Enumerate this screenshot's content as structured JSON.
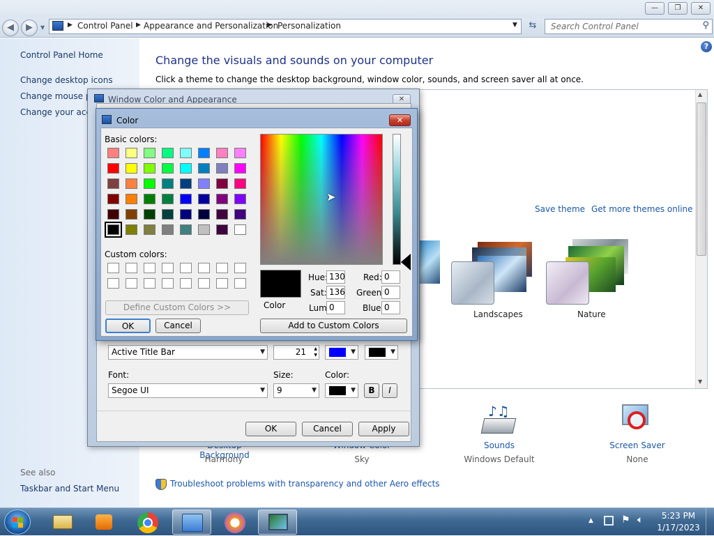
{
  "window": {
    "minimize_glyph": "—",
    "maximize_glyph": "❐",
    "close_glyph": "✕"
  },
  "address": {
    "back_glyph": "◀",
    "forward_glyph": "▶",
    "crumbs": [
      "Control Panel",
      "Appearance and Personalization",
      "Personalization"
    ],
    "search_placeholder": "Search Control Panel"
  },
  "sidebar": {
    "home": "Control Panel Home",
    "links": [
      "Change desktop icons",
      "Change mouse po",
      "Change your acco"
    ],
    "see_also_heading": "See also",
    "see_also_links": [
      "Taskbar and Start Menu"
    ]
  },
  "main": {
    "title": "Change the visuals and sounds on your computer",
    "subtitle": "Click a theme to change the desktop background, window color, sounds, and screen saver all at once.",
    "save_theme": "Save theme",
    "more_themes": "Get more themes online",
    "themes": [
      {
        "name": "Landscapes"
      },
      {
        "name": "Nature"
      }
    ],
    "bottom_items": [
      {
        "label": "Desktop Background",
        "value": "Harmony"
      },
      {
        "label": "Window Color",
        "value": "Sky"
      },
      {
        "label": "Sounds",
        "value": "Windows Default"
      },
      {
        "label": "Screen Saver",
        "value": "None"
      }
    ],
    "troubleshoot": "Troubleshoot problems with transparency and other Aero effects"
  },
  "wca_dialog": {
    "title": "Window Color and Appearance",
    "item_value": "Active Title Bar",
    "size_value": "21",
    "font_label": "Font:",
    "font_value": "Segoe UI",
    "size_label": "Size:",
    "font_size_value": "9",
    "color_label": "Color:",
    "bold_label": "B",
    "italic_label": "I",
    "ok": "OK",
    "cancel": "Cancel",
    "apply": "Apply",
    "color1": "#0000ff",
    "color2": "#000000"
  },
  "color_dialog": {
    "title": "Color",
    "basic_colors_label": "Basic colors:",
    "custom_colors_label": "Custom colors:",
    "define_custom": "Define Custom Colors >>",
    "ok": "OK",
    "cancel": "Cancel",
    "add_custom": "Add to Custom Colors",
    "color_solid_label": "Color",
    "hue_label": "Hue:",
    "hue": "130",
    "sat_label": "Sat:",
    "sat": "136",
    "lum_label": "Lum:",
    "lum": "0",
    "red_label": "Red:",
    "red": "0",
    "green_label": "Green:",
    "green": "0",
    "blue_label": "Blue:",
    "blue": "0",
    "selected_color": "#000000",
    "basic_colors": [
      "#ff8080",
      "#ffff80",
      "#80ff80",
      "#00ff80",
      "#80ffff",
      "#0080ff",
      "#ff80c0",
      "#ff80ff",
      "#ff0000",
      "#ffff00",
      "#80ff00",
      "#00ff40",
      "#00ffff",
      "#0080c0",
      "#8080c0",
      "#ff00ff",
      "#804040",
      "#ff8040",
      "#00ff00",
      "#008080",
      "#004080",
      "#8080ff",
      "#800040",
      "#ff0080",
      "#800000",
      "#ff8000",
      "#008000",
      "#008040",
      "#0000ff",
      "#0000a0",
      "#800080",
      "#8000ff",
      "#400000",
      "#804000",
      "#004000",
      "#004040",
      "#000080",
      "#000040",
      "#400040",
      "#400080",
      "#000000",
      "#808000",
      "#808040",
      "#808080",
      "#408080",
      "#c0c0c0",
      "#400040",
      "#ffffff"
    ]
  },
  "taskbar": {
    "time": "5:23 PM",
    "date": "1/17/2023"
  }
}
